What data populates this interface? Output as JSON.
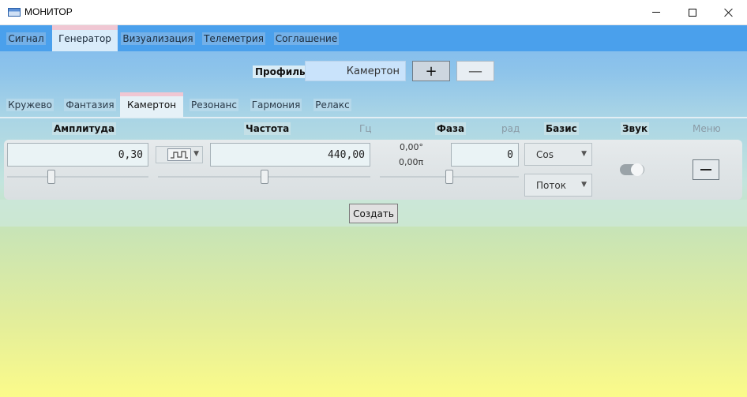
{
  "window": {
    "title": "МОНИТОР"
  },
  "main_tabs": [
    {
      "label": "Сигнал"
    },
    {
      "label": "Генератор",
      "active": true
    },
    {
      "label": "Визуализация"
    },
    {
      "label": "Телеметрия"
    },
    {
      "label": "Соглашение"
    }
  ],
  "profile": {
    "label": "Профиль",
    "value": "Камертон",
    "add_label": "+",
    "remove_label": "—"
  },
  "preset_tabs": [
    {
      "label": "Кружево"
    },
    {
      "label": "Фантазия"
    },
    {
      "label": "Камертон",
      "active": true
    },
    {
      "label": "Резонанс"
    },
    {
      "label": "Гармония"
    },
    {
      "label": "Релакс"
    }
  ],
  "headers": {
    "amplitude": "Амплитуда",
    "frequency": "Частота",
    "frequency_unit": "Гц",
    "phase": "Фаза",
    "phase_unit": "рад",
    "basis": "Базис",
    "sound": "Звук",
    "menu": "Меню"
  },
  "generator": {
    "amplitude_value": "0,30",
    "amplitude_level": 0.3,
    "frequency_value": "440,00",
    "frequency_level": 0.5,
    "phase_degrees": "0,00°",
    "phase_pi": "0,00π",
    "phase_value": "0",
    "phase_level": 0.5,
    "basis_option": "Cos",
    "mode_option": "Поток",
    "sound_on": true,
    "wave_icon": "waveform-icon"
  },
  "create_label": "Создать"
}
